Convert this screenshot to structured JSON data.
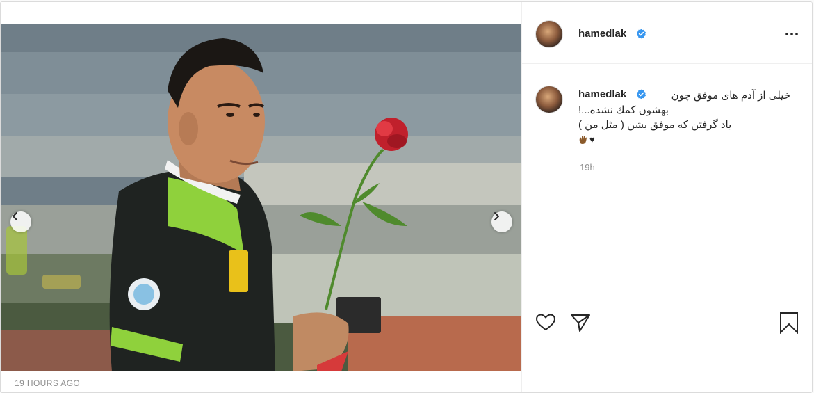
{
  "post": {
    "author": {
      "username": "hamedlak",
      "verified": true,
      "avatar_icon": "profile-avatar"
    },
    "caption": {
      "line1": "خیلی از آدم های موفق چون",
      "line2": "بهشون کمك نشده...!",
      "line3": "یاد گرفتن که موفق بشن ( مثل من )",
      "emojis": [
        "raised-back-of-hand-brown",
        "black-heart"
      ],
      "heart_char": "♥"
    },
    "comment_time": "19h",
    "timestamp": "19 HOURS AGO",
    "media": {
      "type": "carousel",
      "has_prev": true,
      "has_next": true
    },
    "icons": {
      "more": "more-options-icon",
      "like": "heart-outline-icon",
      "share": "paper-plane-icon",
      "save": "bookmark-outline-icon",
      "prev": "chevron-left-icon",
      "next": "chevron-right-icon",
      "verified": "verified-badge-icon"
    },
    "colors": {
      "verified_blue": "#3897f0",
      "text": "#262626",
      "muted": "#8e8e8e",
      "border": "#dbdbdb"
    }
  }
}
